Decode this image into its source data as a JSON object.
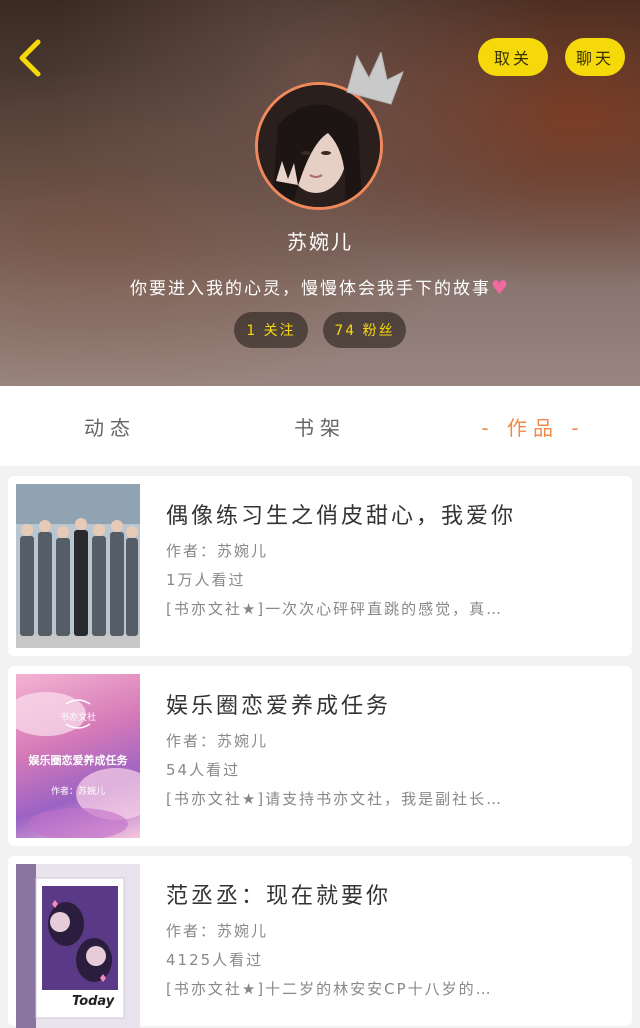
{
  "header": {
    "follow_button": "取关",
    "chat_button": "聊天",
    "username": "苏婉儿",
    "bio": "你要进入我的心灵，慢慢体会我手下的故事",
    "bio_heart": "♥",
    "following": "1 关注",
    "followers": "74 粉丝"
  },
  "tabs": [
    {
      "label": "动态"
    },
    {
      "label": "书架"
    },
    {
      "label": "- 作品 -"
    }
  ],
  "works": [
    {
      "title": "偶像练习生之俏皮甜心，我爱你",
      "author": "作者：苏婉儿",
      "views": "1万人看过",
      "desc": "[书亦文社★]一次次心砰砰直跳的感觉，真…"
    },
    {
      "title": "娱乐圈恋爱养成任务",
      "author": "作者：苏婉儿",
      "views": "54人看过",
      "desc": "[书亦文社★]请支持书亦文社，我是副社长…"
    },
    {
      "title": "范丞丞：现在就要你",
      "author": "作者：苏婉儿",
      "views": "4125人看过",
      "desc": "[书亦文社★]十二岁的林安安CP十八岁的…"
    }
  ],
  "covers": {
    "cover2_text_top": "书亦文社",
    "cover2_text_main": "娱乐圈恋爱养成任务",
    "cover2_text_author": "作者：苏婉儿",
    "cover3_text": "Today"
  },
  "colors": {
    "accent_yellow": "#f5d90a",
    "accent_orange": "#f08a4a",
    "heart_pink": "#f06aa0"
  }
}
